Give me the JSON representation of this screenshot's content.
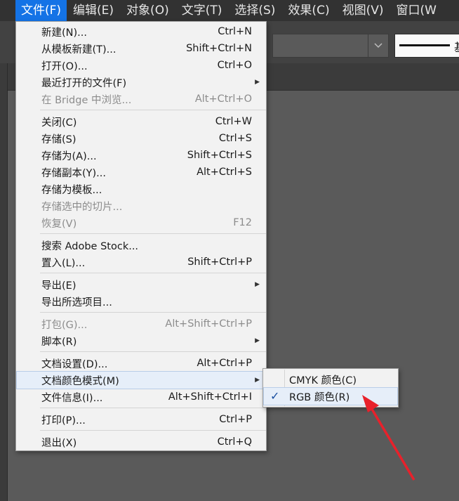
{
  "menubar": {
    "items": [
      "文件(F)",
      "编辑(E)",
      "对象(O)",
      "文字(T)",
      "选择(S)",
      "效果(C)",
      "视图(V)",
      "窗口(W"
    ]
  },
  "control_bar": {
    "stroke_label_partial": "基"
  },
  "file_menu": {
    "items": [
      {
        "label": "新建(N)...",
        "shortcut": "Ctrl+N"
      },
      {
        "label": "从模板新建(T)...",
        "shortcut": "Shift+Ctrl+N"
      },
      {
        "label": "打开(O)...",
        "shortcut": "Ctrl+O"
      },
      {
        "label": "最近打开的文件(F)",
        "shortcut": ""
      },
      {
        "label": "在 Bridge 中浏览...",
        "shortcut": "Alt+Ctrl+O"
      },
      {
        "label": "关闭(C)",
        "shortcut": "Ctrl+W"
      },
      {
        "label": "存储(S)",
        "shortcut": "Ctrl+S"
      },
      {
        "label": "存储为(A)...",
        "shortcut": "Shift+Ctrl+S"
      },
      {
        "label": "存储副本(Y)...",
        "shortcut": "Alt+Ctrl+S"
      },
      {
        "label": "存储为模板...",
        "shortcut": ""
      },
      {
        "label": "存储选中的切片...",
        "shortcut": ""
      },
      {
        "label": "恢复(V)",
        "shortcut": "F12"
      },
      {
        "label": "搜索 Adobe Stock...",
        "shortcut": ""
      },
      {
        "label": "置入(L)...",
        "shortcut": "Shift+Ctrl+P"
      },
      {
        "label": "导出(E)",
        "shortcut": ""
      },
      {
        "label": "导出所选项目...",
        "shortcut": ""
      },
      {
        "label": "打包(G)...",
        "shortcut": "Alt+Shift+Ctrl+P"
      },
      {
        "label": "脚本(R)",
        "shortcut": ""
      },
      {
        "label": "文档设置(D)...",
        "shortcut": "Alt+Ctrl+P"
      },
      {
        "label": "文档颜色模式(M)",
        "shortcut": ""
      },
      {
        "label": "文件信息(I)...",
        "shortcut": "Alt+Shift+Ctrl+I"
      },
      {
        "label": "打印(P)...",
        "shortcut": "Ctrl+P"
      },
      {
        "label": "退出(X)",
        "shortcut": "Ctrl+Q"
      }
    ]
  },
  "color_mode_submenu": {
    "items": [
      {
        "label": "CMYK 颜色(C)",
        "checked": false
      },
      {
        "label": "RGB 颜色(R)",
        "checked": true
      }
    ]
  },
  "colors": {
    "menubar_active": "#1473e6",
    "annotation_arrow": "#e8212b",
    "checkmark": "#1a4fa0"
  },
  "icons": {
    "submenu_arrow": "triangle-right-icon",
    "check": "checkmark-icon",
    "chevron": "chevron-down-icon"
  }
}
